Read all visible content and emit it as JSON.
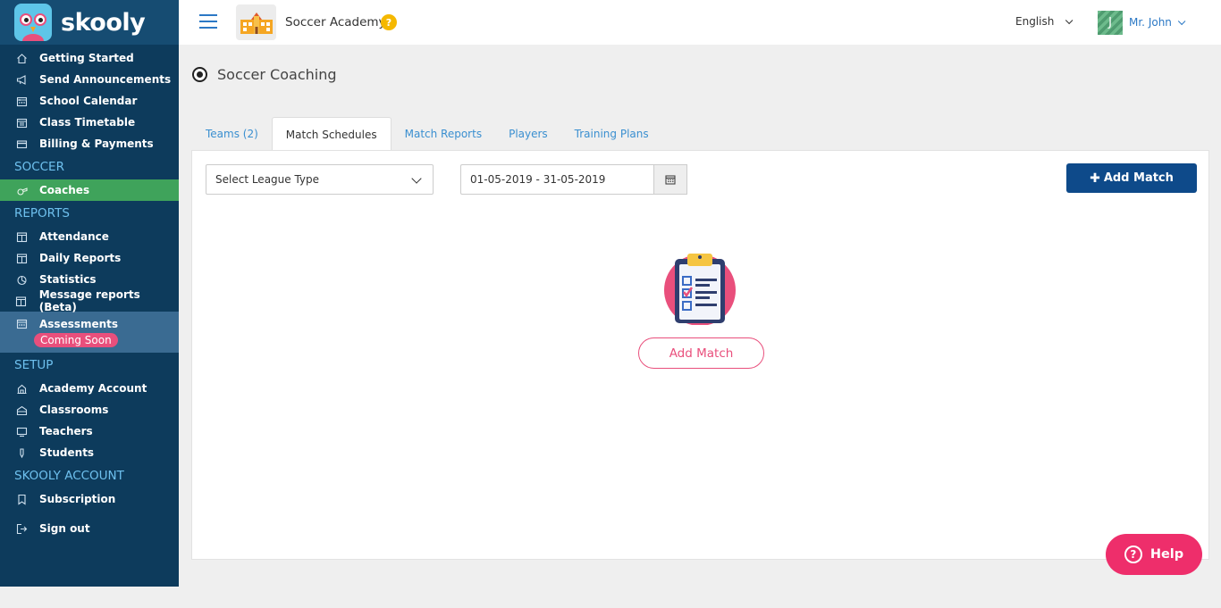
{
  "brand": "skooly",
  "sidebar": {
    "top_items": [
      {
        "label": "Getting Started",
        "icon": "home-icon"
      },
      {
        "label": "Send Announcements",
        "icon": "megaphone-icon"
      },
      {
        "label": "School Calendar",
        "icon": "calendar-icon"
      },
      {
        "label": "Class Timetable",
        "icon": "timetable-icon"
      },
      {
        "label": "Billing & Payments",
        "icon": "card-icon"
      }
    ],
    "section_soccer": "SOCCER",
    "soccer_items": [
      {
        "label": "Coaches",
        "icon": "whistle-icon"
      }
    ],
    "section_reports": "REPORTS",
    "report_items": [
      {
        "label": "Attendance",
        "icon": "report-icon"
      },
      {
        "label": "Daily Reports",
        "icon": "report-icon"
      },
      {
        "label": "Statistics",
        "icon": "pie-icon"
      },
      {
        "label": "Message reports (Beta)",
        "icon": "report-icon"
      }
    ],
    "assessments": {
      "label": "Assessments",
      "badge": "Coming Soon"
    },
    "section_setup": "SETUP",
    "setup_items": [
      {
        "label": "Academy Account",
        "icon": "building-icon"
      },
      {
        "label": "Classrooms",
        "icon": "classroom-icon"
      },
      {
        "label": "Teachers",
        "icon": "teacher-icon"
      },
      {
        "label": "Students",
        "icon": "student-icon"
      }
    ],
    "section_account": "SKOOLY ACCOUNT",
    "account_items": [
      {
        "label": "Subscription",
        "icon": "bookmark-icon"
      }
    ],
    "sign_out": "Sign out"
  },
  "header": {
    "school_name": "Soccer Academy",
    "help_mark": "?",
    "language": "English",
    "avatar_initial": "J",
    "user_name": "Mr. John"
  },
  "page": {
    "title": "Soccer Coaching",
    "tabs": [
      {
        "label": "Teams (2)",
        "active": false
      },
      {
        "label": "Match Schedules",
        "active": true
      },
      {
        "label": "Match Reports",
        "active": false
      },
      {
        "label": "Players",
        "active": false
      },
      {
        "label": "Training Plans",
        "active": false
      }
    ],
    "league_select": "Select League Type",
    "date_range": "01-05-2019 - 31-05-2019",
    "add_match_button": "Add Match",
    "empty_add_match": "Add Match"
  },
  "help_button": "Help",
  "colors": {
    "sidebar_bg": "#0d3b5c",
    "active_green": "#3fa35b",
    "primary_blue": "#0e4a8a",
    "accent_pink": "#e94f7c",
    "help_pink": "#ee2e6b"
  }
}
